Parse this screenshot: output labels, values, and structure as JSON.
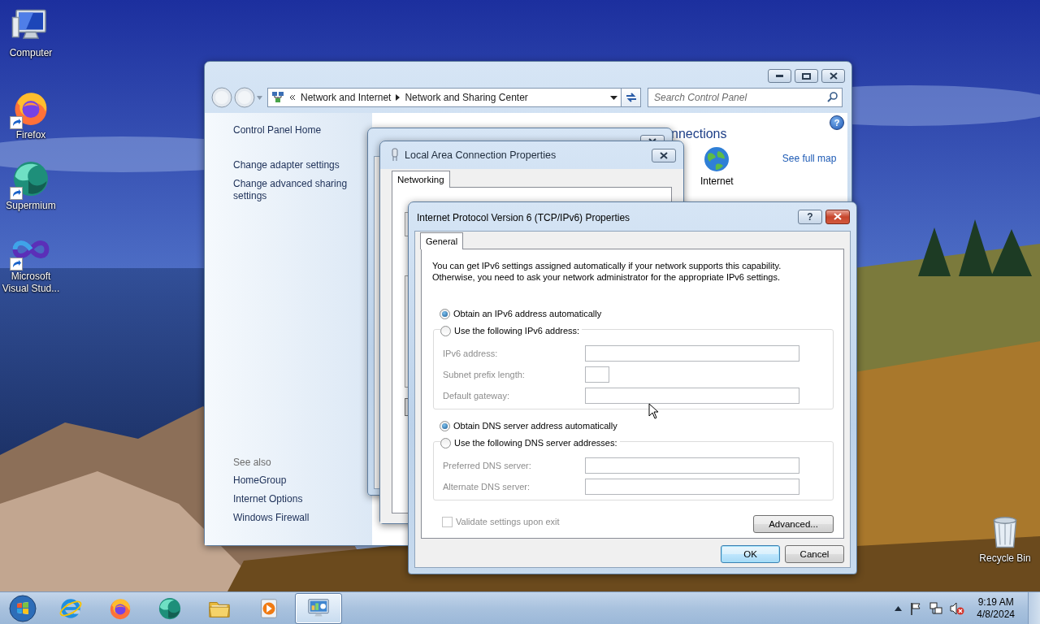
{
  "desktop": {
    "icons": [
      {
        "kind": "computer",
        "label": "Computer",
        "shortcut": false
      },
      {
        "kind": "firefox",
        "label": "Firefox",
        "shortcut": true
      },
      {
        "kind": "supermium",
        "label": "Supermium",
        "shortcut": true
      },
      {
        "kind": "visual-studio",
        "label": "Microsoft Visual Stud...",
        "shortcut": true
      }
    ],
    "recycle_bin": {
      "kind": "recycle-bin",
      "label": "Recycle Bin"
    }
  },
  "control_panel": {
    "breadcrumb": [
      "Network and Internet",
      "Network and Sharing Center"
    ],
    "search": {
      "placeholder": "Search Control Panel"
    },
    "sidebar": {
      "links": [
        "Control Panel Home",
        "Change adapter settings",
        "Change advanced sharing settings"
      ],
      "see_also": {
        "heading": "See also",
        "links": [
          "HomeGroup",
          "Internet Options",
          "Windows Firewall"
        ]
      }
    },
    "help_button": "?",
    "content": {
      "heading": "nnections",
      "network_label": "Internet",
      "map_link": "See full map"
    }
  },
  "connection_properties": {
    "title": "Local Area Connection Properties",
    "tabs": [
      {
        "label": "Networking",
        "selected": true
      }
    ]
  },
  "ipv6_dialog": {
    "title": "Internet Protocol Version 6 (TCP/IPv6) Properties",
    "help_button": "?",
    "tabs": [
      {
        "label": "General",
        "selected": true
      }
    ],
    "description": "You can get IPv6 settings assigned automatically if your network supports this capability.\nOtherwise, you need to ask your network administrator for the appropriate IPv6 settings.",
    "sections": [
      {
        "options": [
          {
            "label": "Obtain an IPv6 address automatically",
            "selected": true
          },
          {
            "label": "Use the following IPv6 address:",
            "selected": false
          }
        ],
        "fields": [
          {
            "label": "IPv6 address:",
            "kind": "wide",
            "disabled": true
          },
          {
            "label": "Subnet prefix length:",
            "kind": "short",
            "disabled": true
          },
          {
            "label": "Default gateway:",
            "kind": "wide",
            "disabled": true
          }
        ]
      },
      {
        "options": [
          {
            "label": "Obtain DNS server address automatically",
            "selected": true
          },
          {
            "label": "Use the following DNS server addresses:",
            "selected": false
          }
        ],
        "fields": [
          {
            "label": "Preferred DNS server:",
            "kind": "wide",
            "disabled": true
          },
          {
            "label": "Alternate DNS server:",
            "kind": "wide",
            "disabled": true
          }
        ]
      }
    ],
    "validate": {
      "label": "Validate settings upon exit",
      "checked": false,
      "disabled": true
    },
    "advanced_button": "Advanced...",
    "buttons": [
      {
        "label": "OK",
        "default": true
      },
      {
        "label": "Cancel",
        "default": false
      }
    ]
  },
  "taskbar": {
    "apps": [
      {
        "kind": "internet-explorer",
        "active": false
      },
      {
        "kind": "firefox",
        "active": false
      },
      {
        "kind": "supermium",
        "active": false
      },
      {
        "kind": "file-explorer",
        "active": false
      },
      {
        "kind": "media-player",
        "active": false
      },
      {
        "kind": "control-panel",
        "active": true
      }
    ],
    "tray": {
      "sound_muted": true,
      "time": "9:19 AM",
      "date": "4/8/2024"
    }
  }
}
